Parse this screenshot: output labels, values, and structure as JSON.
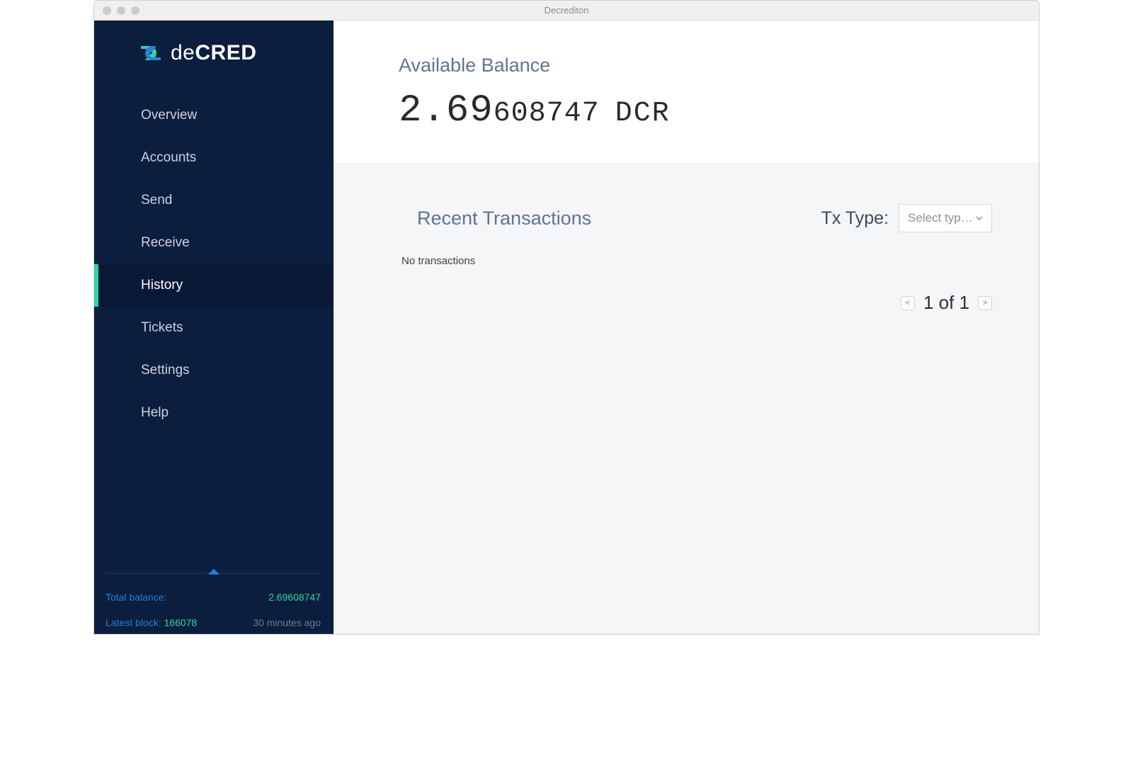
{
  "window": {
    "title": "Decrediton"
  },
  "brand": {
    "thin": "de",
    "bold": "CRED"
  },
  "nav": {
    "items": [
      {
        "label": "Overview"
      },
      {
        "label": "Accounts"
      },
      {
        "label": "Send"
      },
      {
        "label": "Receive"
      },
      {
        "label": "History"
      },
      {
        "label": "Tickets"
      },
      {
        "label": "Settings"
      },
      {
        "label": "Help"
      }
    ],
    "activeIndex": 4
  },
  "sidebar_footer": {
    "total_label": "Total balance:",
    "total_value": "2.69608747",
    "block_label": "Latest block: ",
    "block_number": "166078",
    "block_age": "30 minutes ago"
  },
  "balance": {
    "label": "Available Balance",
    "main": "2.69",
    "decimals": "608747",
    "unit": "DCR"
  },
  "transactions": {
    "title": "Recent Transactions",
    "filter_label": "Tx Type:",
    "select_placeholder": "Select typ…",
    "empty_text": "No transactions"
  },
  "pagination": {
    "prev": "<",
    "next": ">",
    "text": "1 of 1"
  }
}
